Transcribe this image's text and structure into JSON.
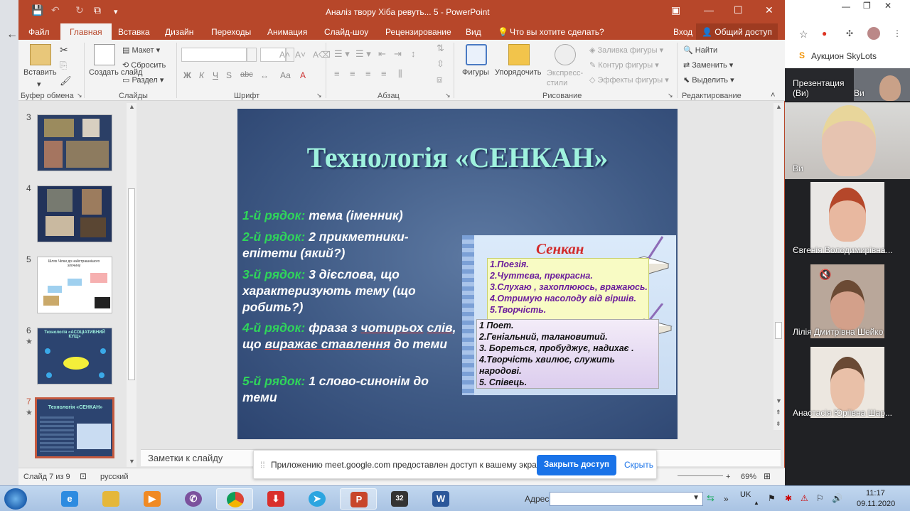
{
  "window": {
    "title": "Аналіз твору Хіба ревуть... 5 - PowerPoint",
    "login": "Вход",
    "share": "Общий доступ"
  },
  "tabs": [
    "Файл",
    "Главная",
    "Вставка",
    "Дизайн",
    "Переходы",
    "Анимация",
    "Слайд-шоу",
    "Рецензирование",
    "Вид",
    "Что вы хотите сделать?"
  ],
  "ribbon": {
    "paste": "Вставить",
    "new_slide": "Создать слайд",
    "layout": "Макет",
    "reset": "Сбросить",
    "section": "Раздел",
    "shapes": "Фигуры",
    "arrange": "Упорядочить",
    "quick_styles": "Экспресс-стили",
    "shape_fill": "Заливка фигуры",
    "shape_outline": "Контур фигуры",
    "shape_effects": "Эффекты фигуры",
    "find": "Найти",
    "replace": "Заменить",
    "select": "Выделить",
    "groups": {
      "clipboard": "Буфер обмена",
      "slides": "Слайды",
      "font": "Шрифт",
      "paragraph": "Абзац",
      "drawing": "Рисование",
      "editing": "Редактирование"
    },
    "font_buttons": [
      "Ж",
      "К",
      "Ч",
      "S",
      "abc",
      "Аа"
    ]
  },
  "thumbnails": [
    {
      "num": "3",
      "star": "",
      "active": false
    },
    {
      "num": "4",
      "star": "",
      "active": false
    },
    {
      "num": "5",
      "star": "",
      "active": false,
      "caption": "Шлях Чіпки до найстрашнішого злочину"
    },
    {
      "num": "6",
      "star": "★",
      "active": false,
      "caption": "Технологія «АСОЦІАТИВНИЙ КУЩ»"
    },
    {
      "num": "7",
      "star": "★",
      "active": true,
      "caption": "Технологія «СЕНКАН»"
    }
  ],
  "slide": {
    "title": "Технологія «СЕНКАН»",
    "rules": [
      {
        "label": "1-й рядок:",
        "text": "тема (іменник)"
      },
      {
        "label": "2-й рядок:",
        "text": "2 прикметники-епітети (який?)"
      },
      {
        "label": "3-й рядок:",
        "text": "3 дієслова, що характеризують тему  (що робить?)"
      },
      {
        "label": "4-й рядок:",
        "text_a": "фраза з ",
        "text_u1": "чотирьох",
        "text_b": " ",
        "text_u2": "слів",
        "text_c": ", що ",
        "text_u3": "виражає ставлення",
        "text_d": " до теми"
      },
      {
        "label": "5-й рядок:",
        "text": "1 слово-синонім до теми"
      }
    ],
    "card_title": "Сенкан",
    "box1": [
      "1.Поезія.",
      "2.Чуттєва, прекрасна.",
      "3.Слухаю , захоплююсь, вражаюсь.",
      "4.Отримую насолоду  від віршів.",
      "5.Творчість."
    ],
    "box2": [
      "1 Поет.",
      "2.Геніальний, талановитий.",
      "3. Бореться, пробуджує, надихає .",
      "4.Творчість хвилює,  служить народові.",
      "5. Співець."
    ]
  },
  "notes": "Заметки к слайду",
  "status": {
    "slide": "Слайд 7 из 9",
    "lang": "русский",
    "zoom": "69%"
  },
  "share_banner": {
    "text": "Приложению meet.google.com предоставлен доступ к вашему экрану.",
    "stop": "Закрыть доступ",
    "hide": "Скрыть"
  },
  "browser": {
    "bookmark": "Аукцион SkyLots"
  },
  "meet": {
    "self_label": "Презентация (Ви)",
    "self_short": "Ви",
    "participants": [
      {
        "name": "Ви"
      },
      {
        "name": "Євгенія Володимирівна..."
      },
      {
        "name": "Лілія Дмитрівна Шейко"
      },
      {
        "name": "Анастасія Юріївна Шар..."
      }
    ]
  },
  "taskbar": {
    "address_label": "Адрес",
    "lang": "UK",
    "time": "11:17",
    "date": "09.11.2020"
  },
  "colors": {
    "ppt_accent": "#b7472a",
    "slide_bg": "#3f5a85",
    "green_label": "#2fd55a",
    "meet_bg": "#202124",
    "share_blue": "#1a73e8"
  }
}
